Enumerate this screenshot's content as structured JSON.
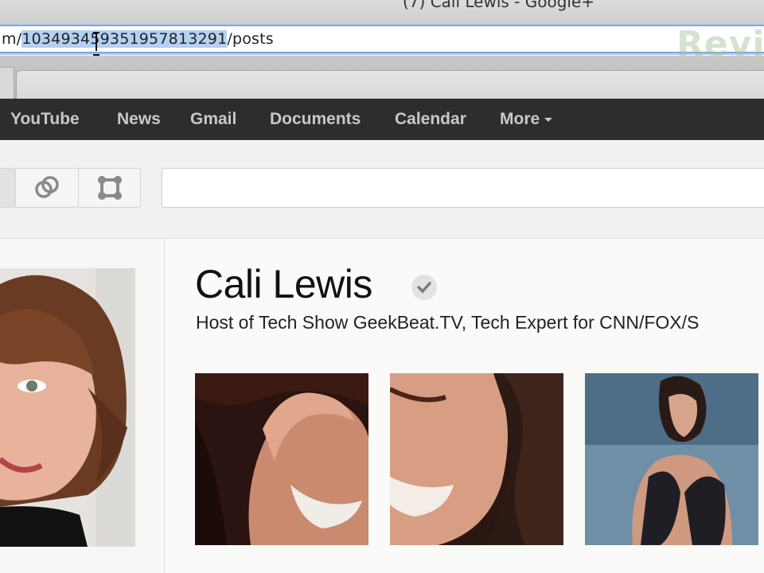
{
  "window": {
    "title": "(7) Cali Lewis - Google+"
  },
  "address_bar": {
    "url_prefix": "m/",
    "url_selected": "103493459351957813291",
    "url_suffix": "/posts"
  },
  "watermark": "Revis",
  "google_bar": {
    "items": [
      {
        "label": "YouTube"
      },
      {
        "label": "News"
      },
      {
        "label": "Gmail"
      },
      {
        "label": "Documents"
      },
      {
        "label": "Calendar"
      },
      {
        "label": "More"
      }
    ]
  },
  "toolbar": {
    "buttons": [
      {
        "icon": "stream-icon",
        "active": true
      },
      {
        "icon": "circles-icon",
        "active": false
      },
      {
        "icon": "hangouts-icon",
        "active": false
      }
    ],
    "search_placeholder": ""
  },
  "profile": {
    "name": "Cali Lewis",
    "tagline": "Host of Tech Show GeekBeat.TV, Tech Expert for CNN/FOX/S",
    "verified": true,
    "photo_count": 3
  },
  "colors": {
    "gbar_bg": "#2d2d2d",
    "gbar_text": "#c8c8c8",
    "selection": "#b5d0f0"
  }
}
